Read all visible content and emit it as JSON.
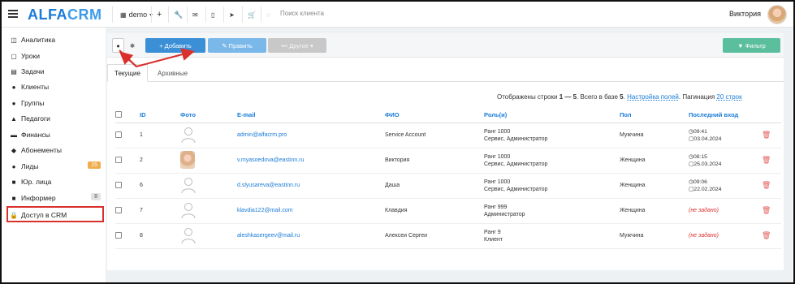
{
  "app": {
    "logo_a": "ALFA",
    "logo_b": "CRM",
    "branch": "demo",
    "search_placeholder": "Поиск клиента",
    "user_name": "Виктория"
  },
  "toolbar_icons": [
    "wrench-icon",
    "mail-icon",
    "phone-icon",
    "telegram-icon",
    "cart-icon",
    "plus-icon"
  ],
  "sidebar": {
    "items": [
      {
        "label": "Аналитика",
        "icon": "chart-icon",
        "glyph": "◫"
      },
      {
        "label": "Уроки",
        "icon": "calendar-icon",
        "glyph": "▢"
      },
      {
        "label": "Задачи",
        "icon": "tasks-icon",
        "glyph": "▤"
      },
      {
        "label": "Клиенты",
        "icon": "user-icon",
        "glyph": "●"
      },
      {
        "label": "Группы",
        "icon": "group-icon",
        "glyph": "●●"
      },
      {
        "label": "Педагоги",
        "icon": "graduation-icon",
        "glyph": "▲"
      },
      {
        "label": "Финансы",
        "icon": "money-icon",
        "glyph": "▬"
      },
      {
        "label": "Абонементы",
        "icon": "tag-icon",
        "glyph": "◆"
      },
      {
        "label": "Лиды",
        "icon": "leads-icon",
        "glyph": "●",
        "badge": "15",
        "badge_style": "orange"
      },
      {
        "label": "Юр. лица",
        "icon": "briefcase-icon",
        "glyph": "■"
      },
      {
        "label": "Информер",
        "icon": "informer-icon",
        "glyph": "■",
        "badge": "8",
        "badge_style": "gray"
      },
      {
        "label": "Доступ в CRM",
        "icon": "lock-icon",
        "glyph": "🔒"
      }
    ]
  },
  "actions": {
    "add": "+ Добавить",
    "edit": "✎ Править",
    "other": "••• Другое ▾",
    "filter": "▼ Фильтр"
  },
  "tabs": [
    "Текущие",
    "Архивные"
  ],
  "info": {
    "prefix": "Отображены строки",
    "range": "1 — 5",
    "total_text": ". Всего в базе",
    "total": "5",
    "dot": ".",
    "fields_link": "Настройка полей",
    "pagination_label": ". Пагинация",
    "pagination_value": "20 строк"
  },
  "table": {
    "headers": [
      "ID",
      "Фото",
      "E-mail",
      "ФИО",
      "Роль(и)",
      "Пол",
      "Последний вход"
    ],
    "rows": [
      {
        "id": "1",
        "photo": "placeholder",
        "email": "admin@alfacrm.pro",
        "name": "Service Account",
        "role1": "Ранг 1000",
        "role2": "Сервис, Администратор",
        "gender": "Мужчина",
        "time": "09:41",
        "date": "03.04.2024"
      },
      {
        "id": "2",
        "photo": "avatar",
        "email": "v.myasoedova@eastinn.ru",
        "name": "Виктория",
        "role1": "Ранг 1000",
        "role2": "Сервис, Администратор",
        "gender": "Женщина",
        "time": "08:15",
        "date": "25.03.2024"
      },
      {
        "id": "6",
        "photo": "placeholder",
        "email": "d.slyusareva@eastinn.ru",
        "name": "Даша",
        "role1": "Ранг 1000",
        "role2": "Сервис, Администратор",
        "gender": "Женщина",
        "time": "09:06",
        "date": "22.02.2024"
      },
      {
        "id": "7",
        "photo": "placeholder",
        "email": "klavdia122@mail.com",
        "name": "Клавдия",
        "role1": "Ранг 999",
        "role2": "Администратор",
        "gender": "Женщина",
        "unset": "(не задано)"
      },
      {
        "id": "8",
        "photo": "placeholder",
        "email": "aleshkasergeev@mail.ru",
        "name": "Алексеи Сергеи",
        "role1": "Ранг 9",
        "role2": "Клиент",
        "gender": "Мужчина",
        "unset": "(не задано)"
      }
    ]
  },
  "colors": {
    "brand": "#1a7bd8",
    "add_button": "#3a8fd6",
    "filter_button": "#5bbf9e",
    "highlight": "#d9302c"
  }
}
